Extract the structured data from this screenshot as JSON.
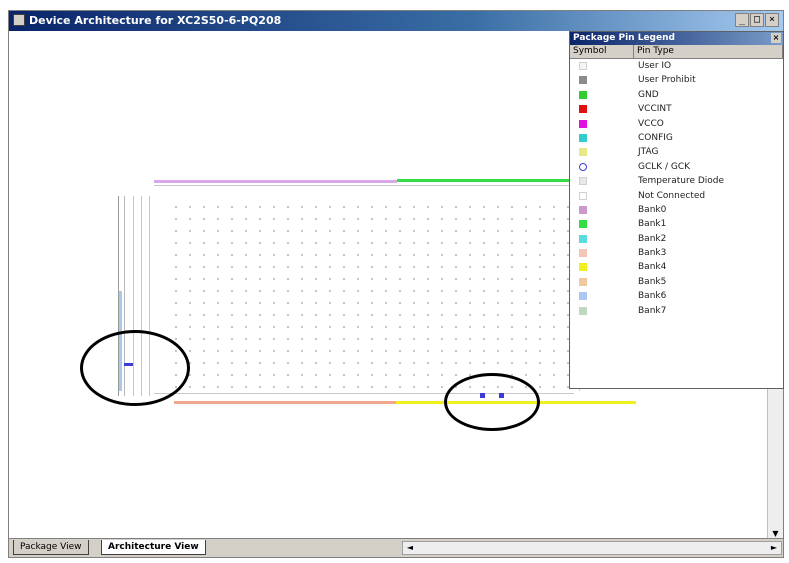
{
  "window": {
    "title": "Device Architecture for XC2S50-6-PQ208",
    "buttons": [
      "_",
      "□",
      "×"
    ]
  },
  "legend": {
    "title": "Package Pin Legend",
    "close_glyph": "×",
    "columns": [
      "Symbol",
      "Pin Type"
    ],
    "items": [
      {
        "label": "User IO",
        "color": "#f5f5f5"
      },
      {
        "label": "User Prohibit",
        "color": "#8c8c8c"
      },
      {
        "label": "GND",
        "color": "#33cc33"
      },
      {
        "label": "VCCINT",
        "color": "#e01010"
      },
      {
        "label": "VCCO",
        "color": "#e010e0"
      },
      {
        "label": "CONFIG",
        "color": "#33cccc"
      },
      {
        "label": "JTAG",
        "color": "#e8e88a"
      },
      {
        "label": "GCLK / GCK",
        "color": "#ffffff"
      },
      {
        "label": "Temperature Diode",
        "color": "#e8e8e8"
      },
      {
        "label": "Not Connected",
        "color": "#ffffff"
      },
      {
        "label": "Bank0",
        "color": "#cc99cc"
      },
      {
        "label": "Bank1",
        "color": "#33dd44"
      },
      {
        "label": "Bank2",
        "color": "#55dddd"
      },
      {
        "label": "Bank3",
        "color": "#f5c6b8"
      },
      {
        "label": "Bank4",
        "color": "#f0f020"
      },
      {
        "label": "Bank5",
        "color": "#f0c8a0"
      },
      {
        "label": "Bank6",
        "color": "#a8c8f0"
      },
      {
        "label": "Bank7",
        "color": "#c0d8c0"
      }
    ]
  },
  "tabs": [
    {
      "label": "Package View",
      "active": false
    },
    {
      "label": "Architecture View",
      "active": true
    }
  ],
  "scroll": {
    "left": "◄",
    "right": "►",
    "up": "▲",
    "down": "▼"
  }
}
